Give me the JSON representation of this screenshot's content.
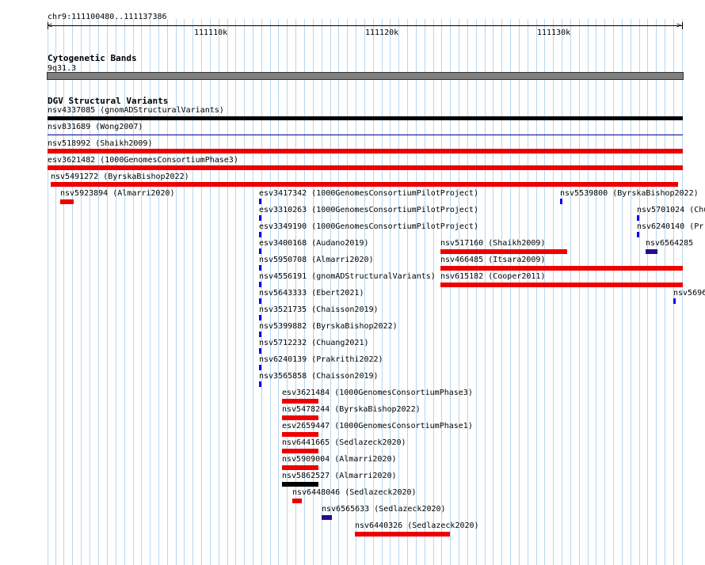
{
  "ruler": {
    "location": "chr9:111100480..111137386",
    "tick_labels": [
      "111110k",
      "111120k",
      "111130k"
    ]
  },
  "cytoband": {
    "track_title": "Cytogenetic Bands",
    "band": "9q31.3"
  },
  "dgv": {
    "track_title": "DGV Structural Variants",
    "features": [
      {
        "id": "nsv4337085",
        "study": "gnomADStructuralVariants",
        "color": "#000000"
      },
      {
        "id": "nsv831689",
        "study": "Wong2007",
        "color": "#00008b"
      },
      {
        "id": "nsv518992",
        "study": "Shaikh2009",
        "color": "#ee0000"
      },
      {
        "id": "esv3621482",
        "study": "1000GenomesConsortiumPhase3",
        "color": "#ee0000"
      },
      {
        "id": "nsv5491272",
        "study": "ByrskaBishop2022",
        "color": "#ee0000"
      },
      {
        "id": "nsv5923894",
        "study": "Almarri2020",
        "color": "#ee0000"
      },
      {
        "id": "esv3417342",
        "study": "1000GenomesConsortiumPilotProject",
        "color": "#0000ee"
      },
      {
        "id": "nsv5539800",
        "study": "ByrskaBishop2022",
        "color": "#0000ee"
      },
      {
        "id": "esv3310263",
        "study": "1000GenomesConsortiumPilotProject",
        "color": "#0000ee"
      },
      {
        "id": "nsv5701024",
        "study": "Chu",
        "color": "#0000ee"
      },
      {
        "id": "esv3349190",
        "study": "1000GenomesConsortiumPilotProject",
        "color": "#0000ee"
      },
      {
        "id": "nsv6240140",
        "study": "Pr",
        "color": "#0000ee"
      },
      {
        "id": "esv3400168",
        "study": "Audano2019",
        "color": "#0000ee"
      },
      {
        "id": "nsv517160",
        "study": "Shaikh2009",
        "color": "#ee0000"
      },
      {
        "id": "nsv6564285",
        "study": "",
        "color": "#2a0a8c"
      },
      {
        "id": "nsv5950708",
        "study": "Almarri2020",
        "color": "#0000ee"
      },
      {
        "id": "nsv466485",
        "study": "Itsara2009",
        "color": "#ee0000"
      },
      {
        "id": "nsv4556191",
        "study": "gnomADStructuralVariants",
        "color": "#0000ee"
      },
      {
        "id": "nsv615182",
        "study": "Cooper2011",
        "color": "#ee0000"
      },
      {
        "id": "nsv5643333",
        "study": "Ebert2021",
        "color": "#0000ee"
      },
      {
        "id": "nsv5696",
        "study": "",
        "color": "#0000ee"
      },
      {
        "id": "nsv3521735",
        "study": "Chaisson2019",
        "color": "#0000ee"
      },
      {
        "id": "nsv5399882",
        "study": "ByrskaBishop2022",
        "color": "#0000ee"
      },
      {
        "id": "nsv5712232",
        "study": "Chuang2021",
        "color": "#0000ee"
      },
      {
        "id": "nsv6240139",
        "study": "Prakrithi2022",
        "color": "#0000ee"
      },
      {
        "id": "nsv3565858",
        "study": "Chaisson2019",
        "color": "#0000ee"
      },
      {
        "id": "esv3621484",
        "study": "1000GenomesConsortiumPhase3",
        "color": "#ee0000"
      },
      {
        "id": "nsv5478244",
        "study": "ByrskaBishop2022",
        "color": "#ee0000"
      },
      {
        "id": "esv2659447",
        "study": "1000GenomesConsortiumPhase1",
        "color": "#ee0000"
      },
      {
        "id": "nsv6441665",
        "study": "Sedlazeck2020",
        "color": "#ee0000"
      },
      {
        "id": "nsv5909004",
        "study": "Almarri2020",
        "color": "#ee0000"
      },
      {
        "id": "nsv5862527",
        "study": "Almarri2020",
        "color": "#000000"
      },
      {
        "id": "nsv6448046",
        "study": "Sedlazeck2020",
        "color": "#ee0000"
      },
      {
        "id": "nsv6565633",
        "study": "Sedlazeck2020",
        "color": "#2a0a8c"
      },
      {
        "id": "nsv6440326",
        "study": "Sedlazeck2020",
        "color": "#ee0000"
      }
    ]
  }
}
